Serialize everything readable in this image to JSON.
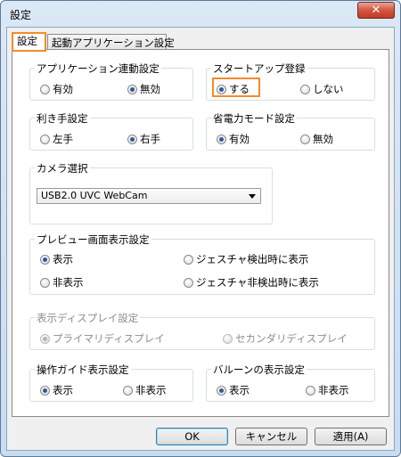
{
  "window": {
    "title": "設定",
    "close_label": "✕"
  },
  "tabs": [
    {
      "label": "設定"
    },
    {
      "label": "起動アプリケーション設定"
    }
  ],
  "app_linkage": {
    "title": "アプリケーション連動設定",
    "options": [
      "有効",
      "無効"
    ],
    "selected": "無効"
  },
  "startup": {
    "title": "スタートアップ登録",
    "options": [
      "する",
      "しない"
    ],
    "selected": "する"
  },
  "handedness": {
    "title": "利き手設定",
    "options": [
      "左手",
      "右手"
    ],
    "selected": "右手"
  },
  "power_save": {
    "title": "省電力モード設定",
    "options": [
      "有効",
      "無効"
    ],
    "selected": "有効"
  },
  "camera": {
    "title": "カメラ選択",
    "selected": "USB2.0 UVC WebCam"
  },
  "preview": {
    "title": "プレビュー画面表示設定",
    "options": [
      "表示",
      "ジェスチャ検出時に表示",
      "非表示",
      "ジェスチャ非検出時に表示"
    ],
    "selected": "表示"
  },
  "display": {
    "title": "表示ディスプレイ設定",
    "options": [
      "プライマリディスプレイ",
      "セカンダリディスプレイ"
    ],
    "selected": "プライマリディスプレイ",
    "disabled": true
  },
  "op_guide": {
    "title": "操作ガイド表示設定",
    "options": [
      "表示",
      "非表示"
    ],
    "selected": "表示"
  },
  "balloon": {
    "title": "バルーンの表示設定",
    "options": [
      "表示",
      "非表示"
    ],
    "selected": "表示"
  },
  "buttons": {
    "ok": "OK",
    "cancel": "キャンセル",
    "apply": "適用(A)"
  },
  "colors": {
    "highlight": "#f18c28",
    "selected_dot": "#2a5a9c"
  }
}
